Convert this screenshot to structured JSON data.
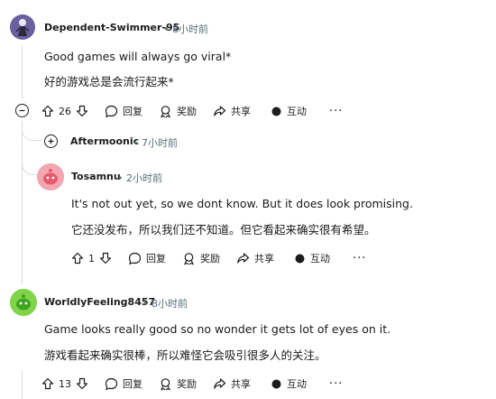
{
  "comments": [
    {
      "author": "Dependent-Swimmer-95",
      "time": "8小时前",
      "text_en": "Good games will always go viral*",
      "text_zh": "好的游戏总是会流行起来*",
      "votes": "26",
      "actions": {
        "reply": "回复",
        "award": "奖励",
        "share": "共享",
        "interact": "互动",
        "more": "···"
      }
    },
    {
      "author": "Aftermoonic",
      "time": "7小时前"
    },
    {
      "author": "Tosamnu",
      "time": "2小时前",
      "text_en": "It's not out yet, so we dont know. But it does look promising.",
      "text_zh": "它还没发布，所以我们还不知道。但它看起来确实很有希望。",
      "votes": "1",
      "actions": {
        "reply": "回复",
        "award": "奖励",
        "share": "共享",
        "interact": "互动",
        "more": "···"
      }
    },
    {
      "author": "WorldlyFeeling8457",
      "time": "8小时前",
      "text_en": "Game looks really good so no wonder it gets lot of eyes on it.",
      "text_zh": "游戏看起来确实很棒，所以难怪它会吸引很多人的关注。",
      "votes": "13",
      "actions": {
        "reply": "回复",
        "award": "奖励",
        "share": "共享",
        "interact": "互动",
        "more": "···"
      }
    }
  ],
  "separator": "•",
  "colors": {
    "avatar_1": "#7b6fb0",
    "avatar_3": "#f2a7b0",
    "avatar_4": "#7fd44a",
    "thread_line": "#d8dde0",
    "meta_text": "#576f76"
  }
}
